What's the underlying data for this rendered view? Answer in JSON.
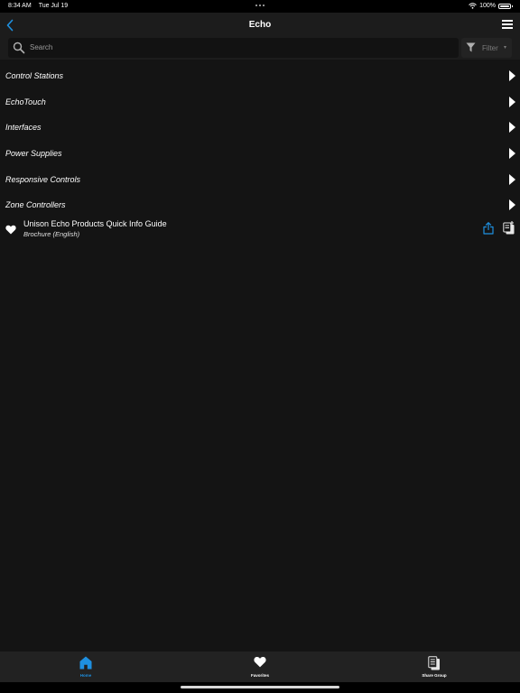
{
  "status_bar": {
    "time": "8:34 AM",
    "date": "Tue Jul 19",
    "battery": "100%",
    "battery_level": 1.0
  },
  "nav": {
    "title": "Echo",
    "back_icon": "chevron-left-icon",
    "menu_icon": "hamburger-menu-icon"
  },
  "search": {
    "placeholder": "Search",
    "value": ""
  },
  "filter": {
    "label": "Filter",
    "icon": "funnel-icon"
  },
  "categories": [
    {
      "label": "Control Stations"
    },
    {
      "label": "EchoTouch"
    },
    {
      "label": "Interfaces"
    },
    {
      "label": "Power Supplies"
    },
    {
      "label": "Responsive Controls"
    },
    {
      "label": "Zone Controllers"
    }
  ],
  "document": {
    "title": "Unison Echo Products Quick Info Guide",
    "subtitle": "Brochure (English)",
    "favorite_icon": "heart-icon",
    "share_icon": "share-icon",
    "add_icon": "add-to-share-group-icon"
  },
  "tabs": [
    {
      "label": "Home",
      "icon": "home-icon",
      "active": true
    },
    {
      "label": "Favorites",
      "icon": "heart-icon",
      "active": false
    },
    {
      "label": "Share Group",
      "icon": "document-icon",
      "active": false
    }
  ],
  "colors": {
    "accent": "#1e90e0",
    "background": "#141414",
    "nav_background": "#1c1c1c",
    "tab_background": "#222222"
  }
}
